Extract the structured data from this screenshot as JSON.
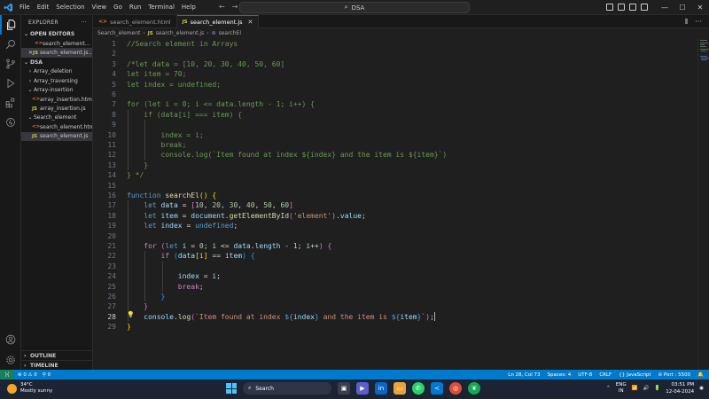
{
  "titlebar": {
    "menu": [
      "File",
      "Edit",
      "Selection",
      "View",
      "Go",
      "Run",
      "Terminal",
      "Help"
    ],
    "search": "DSA"
  },
  "sidebar": {
    "header": "EXPLORER",
    "open_editors_title": "OPEN EDITORS",
    "open_editors": [
      {
        "name": "search_element...",
        "type": "html",
        "active": false
      },
      {
        "name": "search_element.js...",
        "type": "js",
        "active": true
      }
    ],
    "project_title": "DSA",
    "tree": [
      {
        "label": "Array_deletion",
        "kind": "folder",
        "expanded": false,
        "indent": 1
      },
      {
        "label": "Array_traversing",
        "kind": "folder",
        "expanded": false,
        "indent": 1
      },
      {
        "label": "Array-insertion",
        "kind": "folder",
        "expanded": true,
        "indent": 1
      },
      {
        "label": "array_insertion.html",
        "kind": "html",
        "indent": 2
      },
      {
        "label": "array_insertion.js",
        "kind": "js",
        "indent": 2
      },
      {
        "label": "Search_element",
        "kind": "folder",
        "expanded": true,
        "indent": 1
      },
      {
        "label": "search_element.html",
        "kind": "html",
        "indent": 2
      },
      {
        "label": "search_element.js",
        "kind": "js",
        "indent": 2,
        "selected": true
      }
    ],
    "outline": "OUTLINE",
    "timeline": "TIMELINE"
  },
  "tabs": [
    {
      "label": "search_element.html",
      "type": "html",
      "active": false
    },
    {
      "label": "search_element.js",
      "type": "js",
      "active": true
    }
  ],
  "breadcrumbs": [
    "Search_element",
    "search_element.js",
    "searchEl"
  ],
  "editor": {
    "current_line": 28,
    "lines": [
      [
        [
          "comment",
          "//Search element in Arrays"
        ]
      ],
      [],
      [
        [
          "comment",
          "/*let data = [10, 20, 30, 40, 50, 60]"
        ]
      ],
      [
        [
          "comment",
          "let item = 70;"
        ]
      ],
      [
        [
          "comment",
          "let index = undefined;"
        ]
      ],
      [],
      [
        [
          "comment",
          "for (let i = 0; i <= data.length - 1; i++) {"
        ]
      ],
      [
        [
          "comment",
          "    if (data[i] === item) {"
        ]
      ],
      [],
      [
        [
          "comment",
          "        index = i;"
        ]
      ],
      [
        [
          "comment",
          "        break;"
        ]
      ],
      [
        [
          "comment",
          "        console.log(`Item found at index ${index} and the item is ${item}`)"
        ]
      ],
      [
        [
          "comment",
          "    }"
        ]
      ],
      [
        [
          "comment",
          "} */"
        ]
      ],
      [],
      [
        [
          "kw",
          "function "
        ],
        [
          "fn",
          "searchEl"
        ],
        [
          "br1",
          "()"
        ],
        [
          "punc",
          " "
        ],
        [
          "br1",
          "{"
        ]
      ],
      [
        [
          "punc",
          "    "
        ],
        [
          "kw",
          "let "
        ],
        [
          "var",
          "data"
        ],
        [
          "punc",
          " = "
        ],
        [
          "br2",
          "["
        ],
        [
          "num",
          "10"
        ],
        [
          "punc",
          ", "
        ],
        [
          "num",
          "20"
        ],
        [
          "punc",
          ", "
        ],
        [
          "num",
          "30"
        ],
        [
          "punc",
          ", "
        ],
        [
          "num",
          "40"
        ],
        [
          "punc",
          ", "
        ],
        [
          "num",
          "50"
        ],
        [
          "punc",
          ", "
        ],
        [
          "num",
          "60"
        ],
        [
          "br2",
          "]"
        ]
      ],
      [
        [
          "punc",
          "    "
        ],
        [
          "kw",
          "let "
        ],
        [
          "var",
          "item"
        ],
        [
          "punc",
          " = "
        ],
        [
          "var",
          "document"
        ],
        [
          "punc",
          "."
        ],
        [
          "fn",
          "getElementById"
        ],
        [
          "br2",
          "("
        ],
        [
          "str",
          "'element'"
        ],
        [
          "br2",
          ")"
        ],
        [
          "punc",
          "."
        ],
        [
          "var",
          "value"
        ],
        [
          "punc",
          ";"
        ]
      ],
      [
        [
          "punc",
          "    "
        ],
        [
          "kw",
          "let "
        ],
        [
          "var",
          "index"
        ],
        [
          "punc",
          " = "
        ],
        [
          "kw",
          "undefined"
        ],
        [
          "punc",
          ";"
        ]
      ],
      [],
      [
        [
          "punc",
          "    "
        ],
        [
          "ctrl",
          "for "
        ],
        [
          "br2",
          "("
        ],
        [
          "kw",
          "let "
        ],
        [
          "var",
          "i"
        ],
        [
          "punc",
          " = "
        ],
        [
          "num",
          "0"
        ],
        [
          "punc",
          "; "
        ],
        [
          "var",
          "i"
        ],
        [
          "punc",
          " <= "
        ],
        [
          "var",
          "data"
        ],
        [
          "punc",
          "."
        ],
        [
          "var",
          "length"
        ],
        [
          "punc",
          " - "
        ],
        [
          "num",
          "1"
        ],
        [
          "punc",
          "; "
        ],
        [
          "var",
          "i"
        ],
        [
          "punc",
          "++"
        ],
        [
          "br2",
          ")"
        ],
        [
          "punc",
          " "
        ],
        [
          "br2",
          "{"
        ]
      ],
      [
        [
          "punc",
          "        "
        ],
        [
          "ctrl",
          "if "
        ],
        [
          "br3",
          "("
        ],
        [
          "var",
          "data"
        ],
        [
          "br1",
          "["
        ],
        [
          "var",
          "i"
        ],
        [
          "br1",
          "]"
        ],
        [
          "punc",
          " == "
        ],
        [
          "var",
          "item"
        ],
        [
          "br3",
          ")"
        ],
        [
          "punc",
          " "
        ],
        [
          "br3",
          "{"
        ]
      ],
      [],
      [
        [
          "punc",
          "            "
        ],
        [
          "var",
          "index"
        ],
        [
          "punc",
          " = "
        ],
        [
          "var",
          "i"
        ],
        [
          "punc",
          ";"
        ]
      ],
      [
        [
          "punc",
          "            "
        ],
        [
          "ctrl",
          "break"
        ],
        [
          "punc",
          ";"
        ]
      ],
      [
        [
          "punc",
          "        "
        ],
        [
          "br3",
          "}"
        ]
      ],
      [
        [
          "punc",
          "    "
        ],
        [
          "br2",
          "}"
        ]
      ],
      [
        [
          "punc",
          "    "
        ],
        [
          "var",
          "console"
        ],
        [
          "punc",
          "."
        ],
        [
          "fn",
          "log"
        ],
        [
          "br2",
          "("
        ],
        [
          "str",
          "`Item found at index "
        ],
        [
          "kw",
          "${"
        ],
        [
          "var",
          "index"
        ],
        [
          "kw",
          "}"
        ],
        [
          "str",
          " and the item is "
        ],
        [
          "kw",
          "${"
        ],
        [
          "var",
          "item"
        ],
        [
          "kw",
          "}"
        ],
        [
          "str",
          "`"
        ],
        [
          "br2",
          ")"
        ],
        [
          "punc",
          ";"
        ]
      ],
      [
        [
          "br1",
          "}"
        ]
      ]
    ]
  },
  "statusbar": {
    "problems": "⊗ 0 ⚠ 0",
    "ports": "⚲ 0",
    "position": "Ln 28, Col 73",
    "spaces": "Spaces: 4",
    "encoding": "UTF-8",
    "eol": "CRLF",
    "language": "{} JavaScript",
    "port": "⊘ Port : 5500"
  },
  "taskbar": {
    "temperature": "34°C",
    "weather": "Mostly sunny",
    "search_label": "Search",
    "language": "ENG",
    "region": "IN",
    "time": "03:51 PM",
    "date": "12-04-2024"
  },
  "colors": {
    "accent": "#0078d4",
    "statusbar": "#007acc",
    "comment": "#6a9955",
    "keyword": "#569cd6"
  }
}
